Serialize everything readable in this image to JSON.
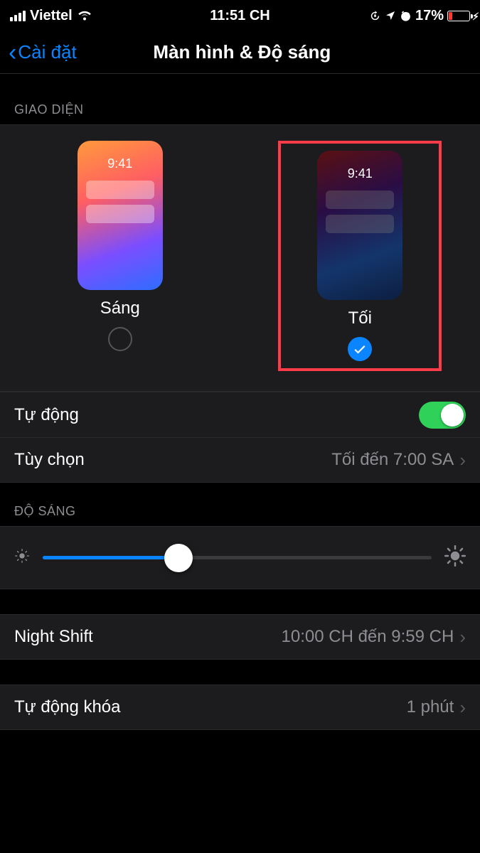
{
  "statusbar": {
    "carrier": "Viettel",
    "time": "11:51 CH",
    "battery_pct": "17%"
  },
  "nav": {
    "back": "Cài đặt",
    "title": "Màn hình & Độ sáng"
  },
  "sections": {
    "appearance_header": "GIAO DIỆN",
    "brightness_header": "ĐỘ SÁNG"
  },
  "appearance": {
    "light_label": "Sáng",
    "dark_label": "Tối",
    "preview_time": "9:41",
    "selected": "dark"
  },
  "rows": {
    "automatic": {
      "label": "Tự động",
      "on": true
    },
    "options": {
      "label": "Tùy chọn",
      "detail": "Tối đến 7:00 SA"
    },
    "nightshift": {
      "label": "Night Shift",
      "detail": "10:00 CH đến 9:59 CH"
    },
    "autolock": {
      "label": "Tự động khóa",
      "detail": "1 phút"
    }
  },
  "brightness": {
    "value_pct": 35
  }
}
